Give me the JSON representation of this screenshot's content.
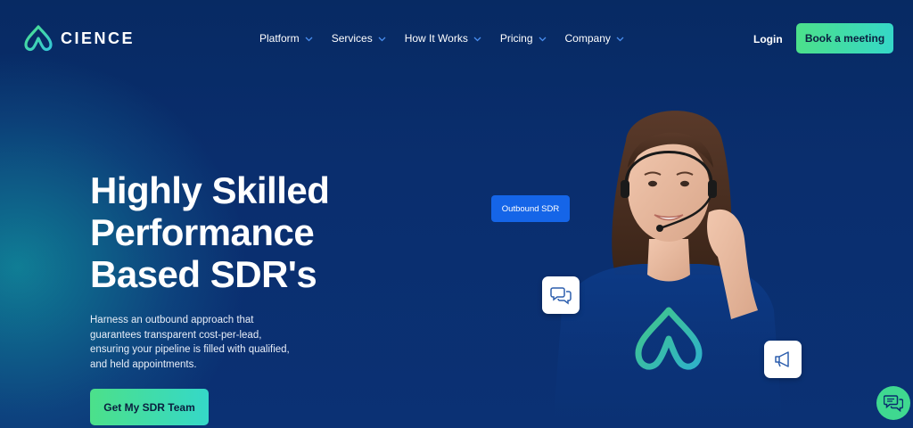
{
  "header": {
    "logo_text": "CIENCE",
    "nav": [
      {
        "label": "Platform",
        "icon": "chevron-down-icon"
      },
      {
        "label": "Services",
        "icon": "chevron-down-icon"
      },
      {
        "label": "How It Works",
        "icon": "chevron-down-icon"
      },
      {
        "label": "Pricing",
        "icon": "chevron-down-icon"
      },
      {
        "label": "Company",
        "icon": "chevron-down-icon"
      }
    ],
    "login_label": "Login",
    "cta_label": "Book a meeting"
  },
  "hero": {
    "title_lines": [
      "Highly Skilled",
      "Performance",
      "Based SDR's"
    ],
    "description": "Harness an outbound approach that guarantees transparent cost-per-lead, ensuring your pipeline is filled with qualified, and held appointments.",
    "cta_label": "Get My SDR Team"
  },
  "illustration": {
    "tag_label": "Outbound SDR",
    "floating_icons": [
      "chat-bubbles-icon",
      "megaphone-icon"
    ]
  },
  "chat_widget": {
    "icon": "chat-icon"
  },
  "colors": {
    "background": "#0a2e6e",
    "accent_gradient_start": "#4ce08a",
    "accent_gradient_end": "#35d8c8",
    "tag_blue": "#1565e8",
    "chat_widget": "#3fd890"
  }
}
